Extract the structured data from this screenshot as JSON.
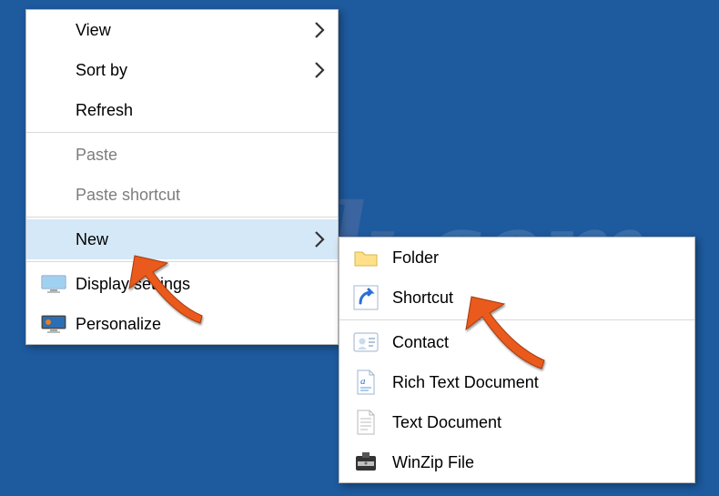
{
  "watermark": "pcrisk.com",
  "main_menu": {
    "items": [
      {
        "label": "View",
        "has_submenu": true,
        "disabled": false,
        "icon": null,
        "hover": false
      },
      {
        "label": "Sort by",
        "has_submenu": true,
        "disabled": false,
        "icon": null,
        "hover": false
      },
      {
        "label": "Refresh",
        "has_submenu": false,
        "disabled": false,
        "icon": null,
        "hover": false
      },
      {
        "sep": true
      },
      {
        "label": "Paste",
        "has_submenu": false,
        "disabled": true,
        "icon": null,
        "hover": false
      },
      {
        "label": "Paste shortcut",
        "has_submenu": false,
        "disabled": true,
        "icon": null,
        "hover": false
      },
      {
        "sep": true
      },
      {
        "label": "New",
        "has_submenu": true,
        "disabled": false,
        "icon": null,
        "hover": true
      },
      {
        "sep": true
      },
      {
        "label": "Display settings",
        "has_submenu": false,
        "disabled": false,
        "icon": "monitor",
        "hover": false
      },
      {
        "label": "Personalize",
        "has_submenu": false,
        "disabled": false,
        "icon": "personalize",
        "hover": false
      }
    ]
  },
  "sub_menu": {
    "items": [
      {
        "label": "Folder",
        "icon": "folder",
        "hover": false
      },
      {
        "label": "Shortcut",
        "icon": "shortcut",
        "hover": false
      },
      {
        "sep": true
      },
      {
        "label": "Contact",
        "icon": "contact",
        "hover": false
      },
      {
        "label": "Rich Text Document",
        "icon": "rtf",
        "hover": false
      },
      {
        "label": "Text Document",
        "icon": "text",
        "hover": false
      },
      {
        "label": "WinZip File",
        "icon": "winzip",
        "hover": false
      }
    ]
  },
  "annotations": {
    "arrow1_target": "New",
    "arrow2_target": "Shortcut"
  }
}
